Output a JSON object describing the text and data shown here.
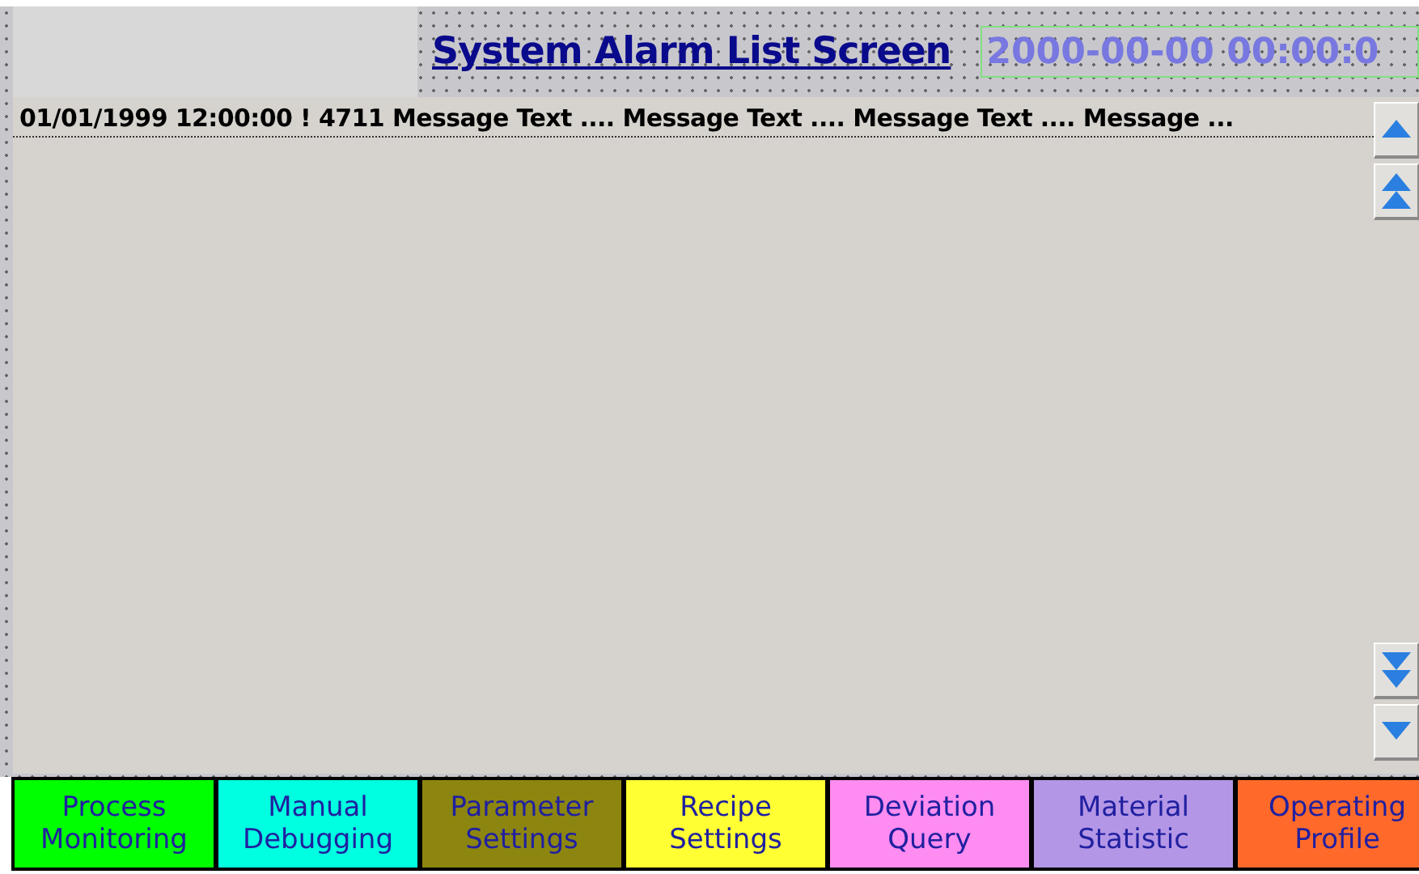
{
  "header": {
    "title": "System Alarm List Screen",
    "clock": "2000-00-00 00:00:0"
  },
  "alarm_list": {
    "rows": [
      "01/01/1999 12:00:00 ! 4711 Message Text .... Message Text .... Message Text .... Message ..."
    ]
  },
  "nav_buttons": [
    {
      "label": "Process Monitoring",
      "color": "#00ff00"
    },
    {
      "label": "Manual Debugging",
      "color": "#00ffe0"
    },
    {
      "label": "Parameter Settings",
      "color": "#8c8610"
    },
    {
      "label": "Recipe Settings",
      "color": "#ffff33"
    },
    {
      "label": "Deviation Query",
      "color": "#ff8cf0"
    },
    {
      "label": "Material Statistic",
      "color": "#b496e6"
    },
    {
      "label": "Operating Profile",
      "color": "#ff6a2a"
    }
  ]
}
